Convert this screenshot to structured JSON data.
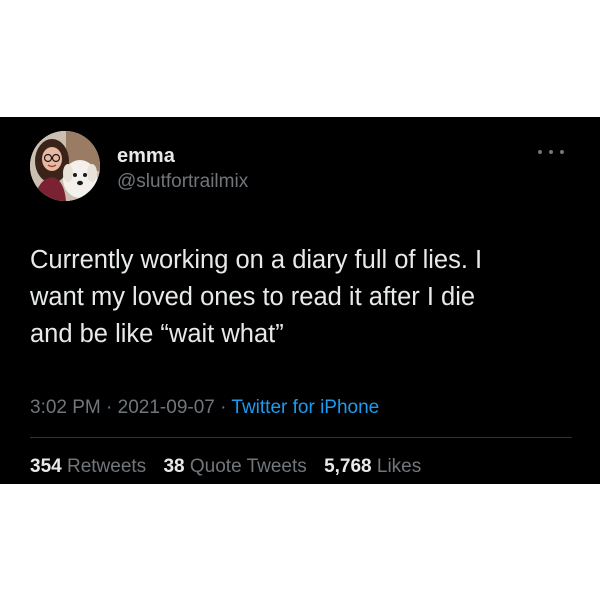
{
  "user": {
    "display_name": "emma",
    "handle": "@slutfortrailmix"
  },
  "tweet": {
    "text": "Currently working on a diary full of lies. I\nwant my loved ones to read it after I die\nand be like “wait what”",
    "time": "3:02 PM",
    "date": "2021-09-07",
    "separator": " · ",
    "source": "Twitter for iPhone"
  },
  "stats": {
    "retweets": {
      "count": "354",
      "label": "Retweets"
    },
    "quotes": {
      "count": "38",
      "label": "Quote Tweets"
    },
    "likes": {
      "count": "5,768",
      "label": "Likes"
    }
  },
  "colors": {
    "background": "#000000",
    "text": "#e7e9ea",
    "secondary": "#71767b",
    "link": "#1d9bf0"
  },
  "icons": {
    "more": "more-horizontal-icon"
  }
}
